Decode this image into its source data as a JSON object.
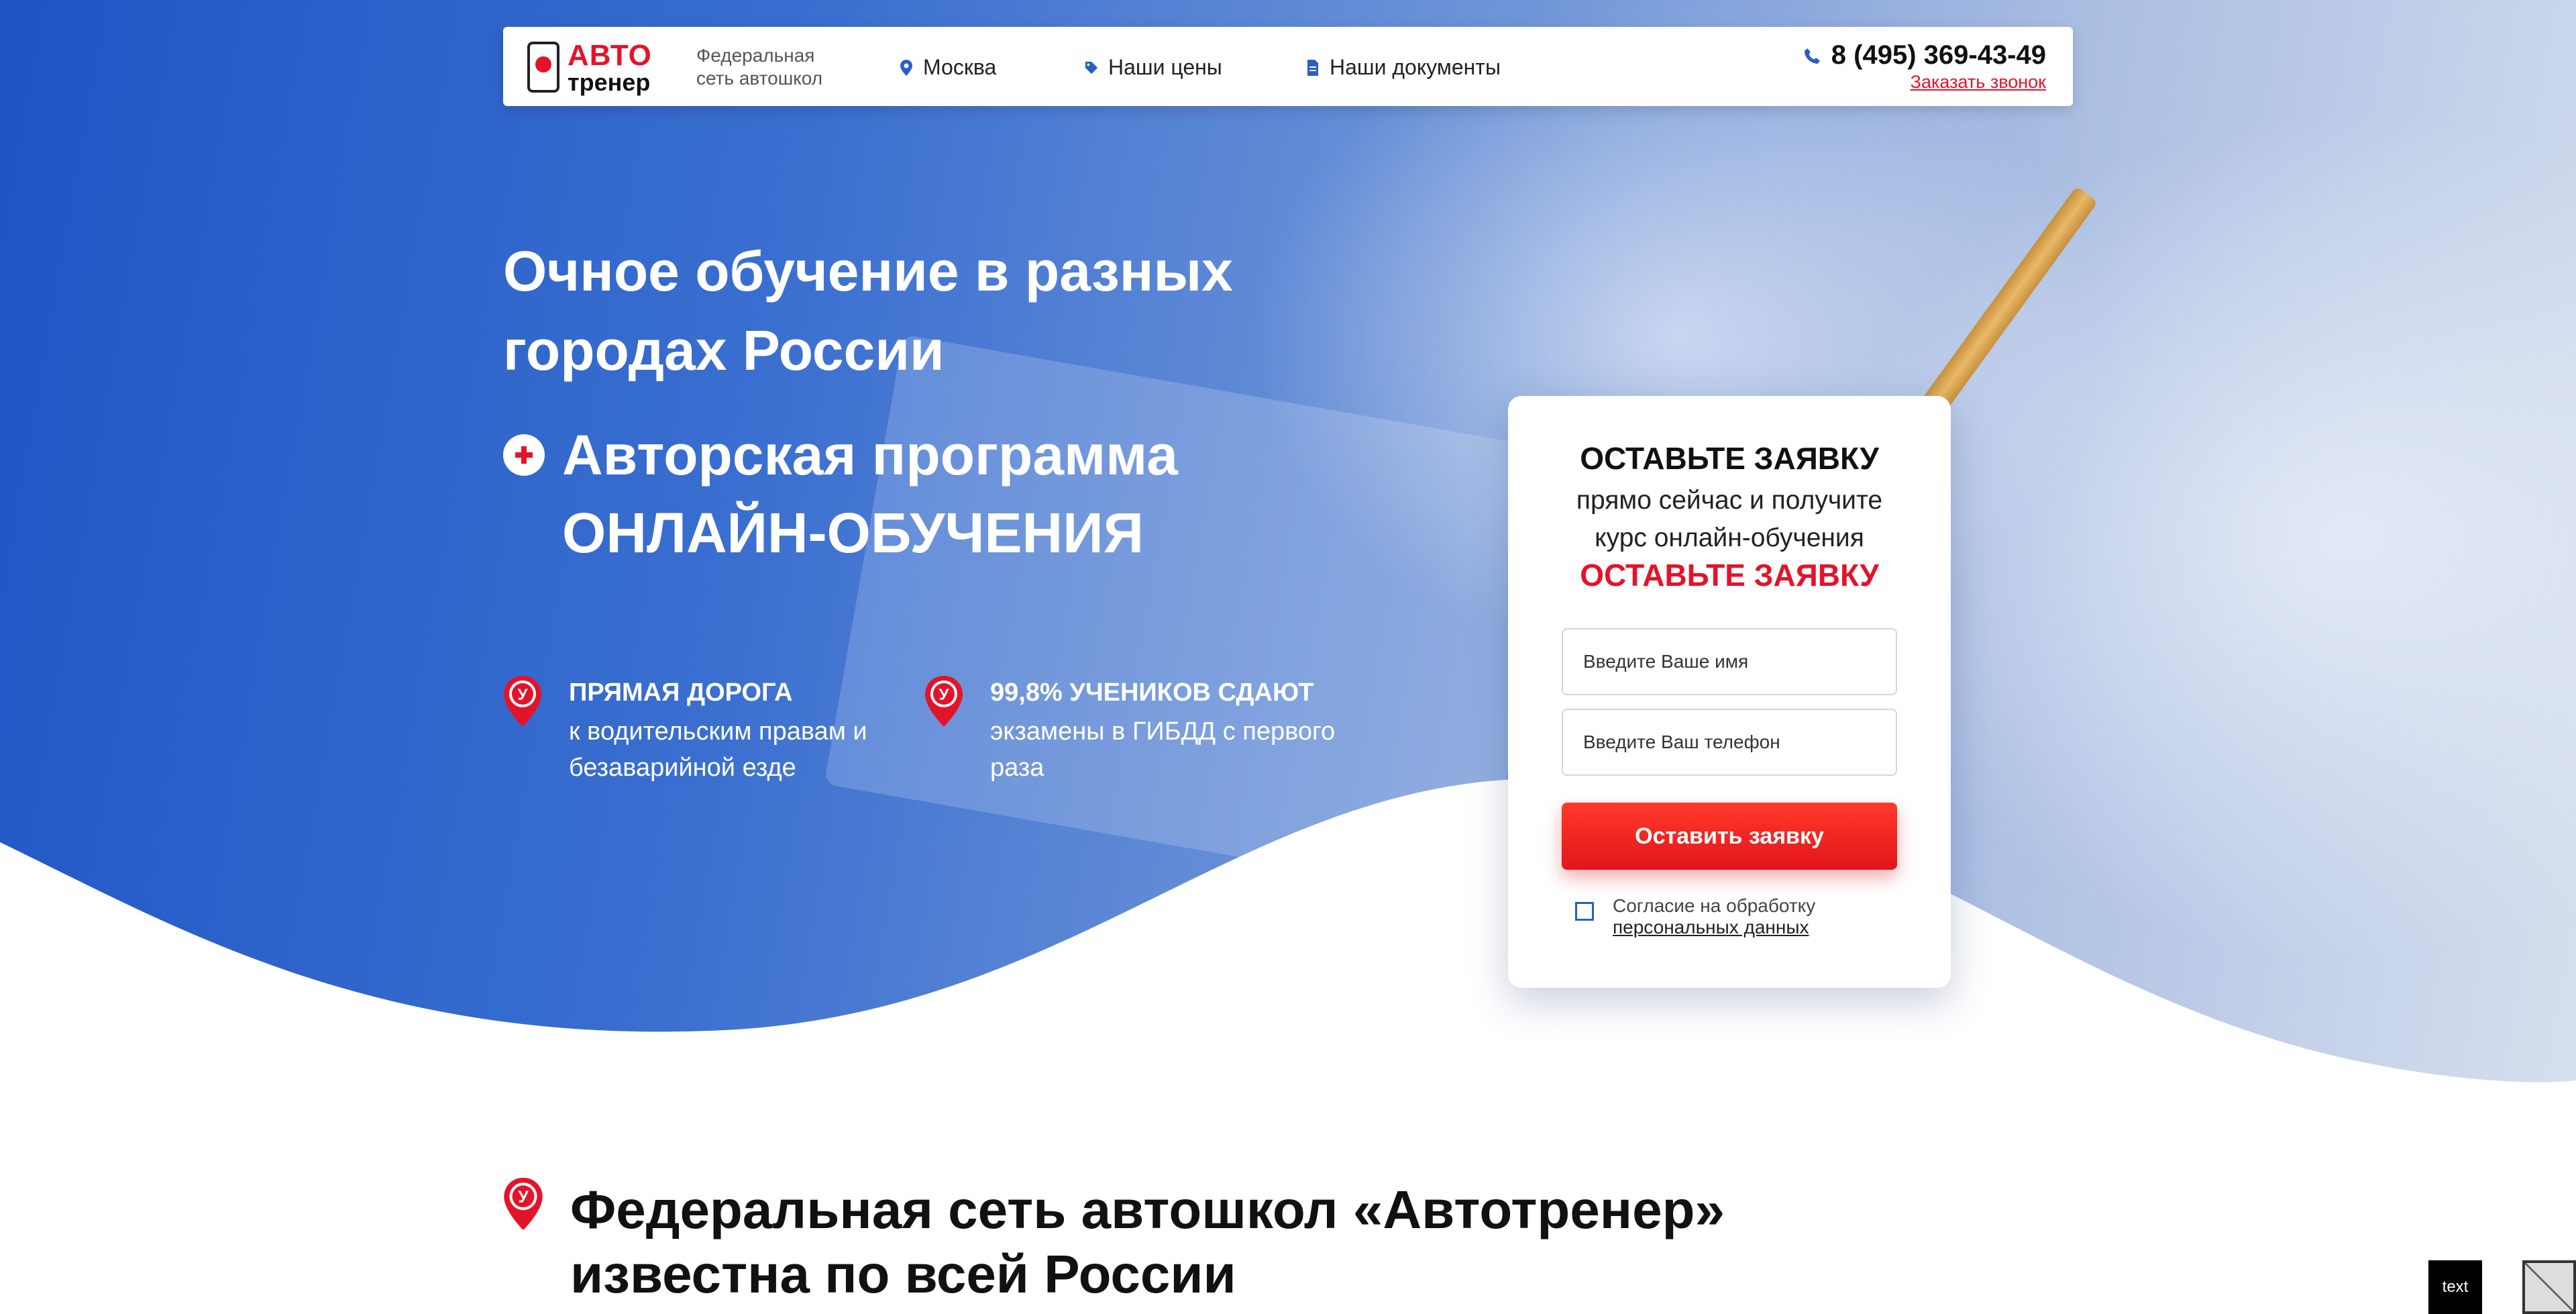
{
  "header": {
    "logo": {
      "line1": "АВТО",
      "line2": "тренер"
    },
    "brand_sub": "Федеральная сеть автошкол",
    "nav": [
      {
        "label": "Москва",
        "icon": "location-pin-icon"
      },
      {
        "label": "Наши цены",
        "icon": "price-tag-icon"
      },
      {
        "label": "Наши документы",
        "icon": "document-icon"
      }
    ],
    "phone": "8 (495) 369-43-49",
    "callback": "Заказать звонок"
  },
  "hero": {
    "title": "Очное обучение в разных городах России",
    "subtitle": "Авторская программа ОНЛАЙН-ОБУЧЕНИЯ",
    "features": [
      {
        "title": "ПРЯМАЯ ДОРОГА",
        "text": "к водительским правам и безаварийной езде"
      },
      {
        "title": "99,8% УЧЕНИКОВ СДАЮТ",
        "text": "экзамены в ГИБДД с первого раза"
      }
    ]
  },
  "form": {
    "title": "ОСТАВЬТЕ ЗАЯВКУ",
    "text": "прямо сейчас и получите курс онлайн-обучения",
    "accent": "ОСТАВЬТЕ ЗАЯВКУ",
    "name_placeholder": "Введите Ваше имя",
    "phone_placeholder": "Введите Ваш телефон",
    "submit": "Оставить заявку",
    "consent_text": "Согласие на обработку",
    "consent_link": "персональных данных"
  },
  "section": {
    "title": "Федеральная сеть автошкол «Автотренер» известна по всей России"
  },
  "badge": {
    "text": "text"
  },
  "colors": {
    "accent": "#e3142a",
    "brand_blue": "#1f55c4"
  }
}
